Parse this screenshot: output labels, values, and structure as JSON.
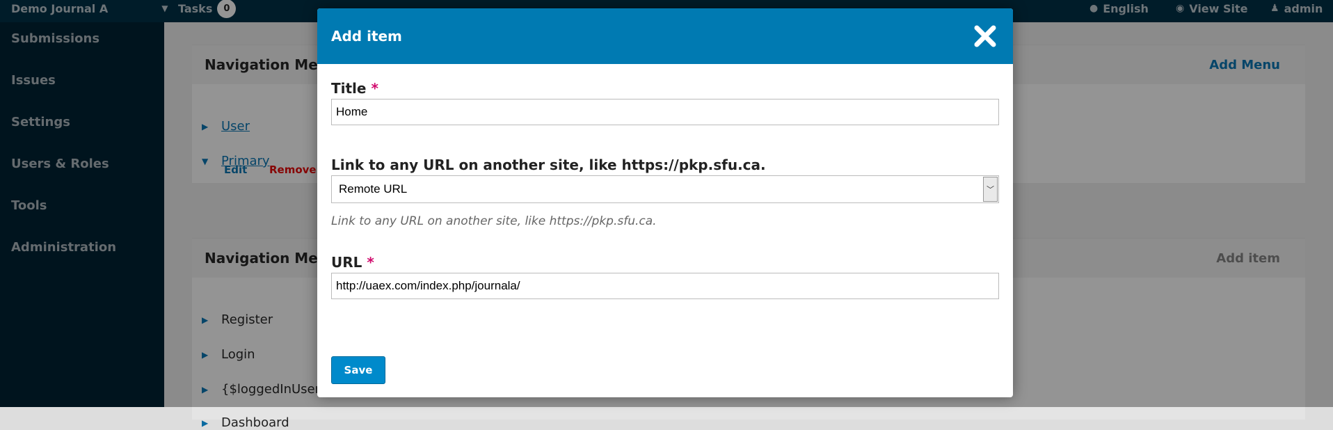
{
  "topbar": {
    "journal": "Demo Journal A",
    "tasks_label": "Tasks",
    "tasks_count": "0",
    "language": "English",
    "view_site": "View Site",
    "user": "admin"
  },
  "sidebar": {
    "items": [
      {
        "label": "Submissions"
      },
      {
        "label": "Issues"
      },
      {
        "label": "Settings"
      },
      {
        "label": "Users & Roles"
      },
      {
        "label": "Tools"
      },
      {
        "label": "Administration"
      }
    ]
  },
  "background": {
    "menus_panel": {
      "title": "Navigation Menu",
      "action": "Add Menu",
      "items": [
        "User",
        "Primary"
      ],
      "edit": "Edit",
      "remove": "Remove"
    },
    "items_panel": {
      "title": "Navigation Menu",
      "action": "Add item",
      "items": [
        "Register",
        "Login",
        "{$loggedInUserna",
        "Dashboard"
      ]
    }
  },
  "modal": {
    "title": "Add item",
    "title_label": "Title",
    "title_value": "Home",
    "type_label": "Link to any URL on another site, like https://pkp.sfu.ca.",
    "type_value": "Remote URL",
    "type_hint": "Link to any URL on another site, like https://pkp.sfu.ca.",
    "url_label": "URL",
    "url_value": "http://uaex.com/index.php/journala/",
    "required_mark": "*",
    "save": "Save"
  },
  "colors": {
    "header_blue": "#007ab2",
    "button_blue": "#008acb",
    "required": "#d00a6c",
    "remove_red": "#d00a0a"
  }
}
